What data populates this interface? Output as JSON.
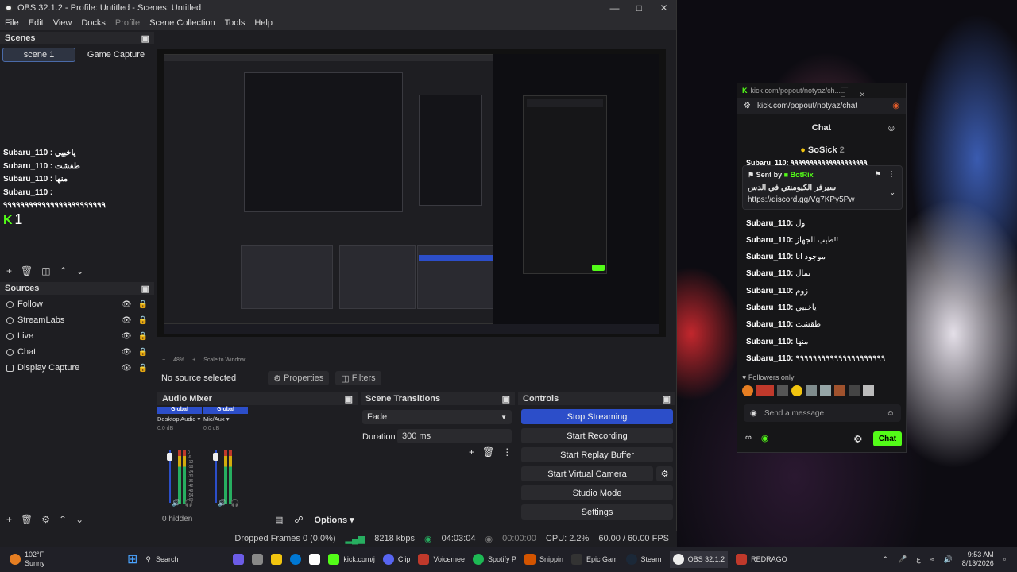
{
  "window": {
    "title": "OBS 32.1.2 - Profile: Untitled - Scenes: Untitled"
  },
  "menu": [
    "File",
    "Edit",
    "View",
    "Docks",
    "Profile",
    "Scene Collection",
    "Tools",
    "Help"
  ],
  "scenes": {
    "title": "Scenes",
    "items": [
      "scene 1",
      "Game Capture"
    ],
    "overlay_lines": [
      "Subaru_110 : ياخبيي",
      "Subaru_110 : طقشت",
      "Subaru_110 : منها",
      "Subaru_110 : ٩٩٩٩٩٩٩٩٩٩٩٩٩٩٩٩٩٩٩٩٩٩٩٩"
    ],
    "overlay_count": "1"
  },
  "sources": {
    "title": "Sources",
    "items": [
      "Follow",
      "StreamLabs",
      "Live",
      "Chat",
      "Display Capture"
    ]
  },
  "preview": {
    "zoom": "48%",
    "scale_mode": "Scale to Window"
  },
  "properties_bar": {
    "no_source": "No source selected",
    "properties": "Properties",
    "filters": "Filters"
  },
  "audio_mixer": {
    "title": "Audio Mixer",
    "channels": [
      {
        "badge": "Global",
        "name": "Desktop Audio",
        "db": "0.0 dB"
      },
      {
        "badge": "Global",
        "name": "Mic/Aux",
        "db": "0.0 dB"
      }
    ],
    "scale": [
      "0",
      "-6",
      "-12",
      "-18",
      "-24",
      "-30",
      "-36",
      "-42",
      "-48",
      "-54",
      "-60"
    ],
    "hidden": "0 hidden",
    "options": "Options"
  },
  "transitions": {
    "title": "Scene Transitions",
    "selected": "Fade",
    "duration_label": "Duration",
    "duration": "300 ms"
  },
  "controls": {
    "title": "Controls",
    "buttons": [
      "Stop Streaming",
      "Start Recording",
      "Start Replay Buffer",
      "Start Virtual Camera",
      "Studio Mode",
      "Settings"
    ]
  },
  "status": {
    "dropped": "Dropped Frames 0 (0.0%)",
    "bitrate": "8218 kbps",
    "live_time": "04:03:04",
    "rec_time": "00:00:00",
    "cpu": "CPU: 2.2%",
    "fps": "60.00 / 60.00 FPS"
  },
  "kick": {
    "url": "kick.com/popout/notyaz/chat",
    "title_bar": "kick.com/popout/notyaz/ch...",
    "header": "Chat",
    "gifter": "SoSick",
    "gifter_count": "2",
    "top_cut": "Subaru_110: ٩٩٩٩٩٩٩٩٩٩٩٩٩٩٩٩٩٩٩٩",
    "pinned_by": "Sent by",
    "pinned_user": "BotRix",
    "pinned_text": "سيرفر الكيومنتي في الدس",
    "pinned_link": "https://discord.gg/Vg7KPy5Pw",
    "messages": [
      [
        "Subaru_110:",
        "ول"
      ],
      [
        "Subaru_110:",
        "طيب الجهاز!!"
      ],
      [
        "Subaru_110:",
        "موجود انا"
      ],
      [
        "Subaru_110:",
        "تمال"
      ],
      [
        "Subaru_110:",
        "زوم"
      ],
      [
        "Subaru_110:",
        "ياخبيي"
      ],
      [
        "Subaru_110:",
        "طقشت"
      ],
      [
        "Subaru_110:",
        "منها"
      ],
      [
        "Subaru_110:",
        "٩٩٩٩٩٩٩٩٩٩٩٩٩٩٩٩٩٩٩٩٩"
      ]
    ],
    "followers_only": "Followers only",
    "placeholder": "Send a message",
    "chat_button": "Chat"
  },
  "taskbar": {
    "weather_temp": "102°F",
    "weather_desc": "Sunny",
    "search": "Search",
    "apps": [
      "kick.com/j",
      "Clip",
      "Voicemee",
      "Spotify P",
      "Snippin",
      "Epic Gam",
      "Steam",
      "OBS 32.1.2",
      "REDRAGO"
    ],
    "time": "9:53 AM",
    "date": "8/13/2026",
    "lang": "ع"
  }
}
